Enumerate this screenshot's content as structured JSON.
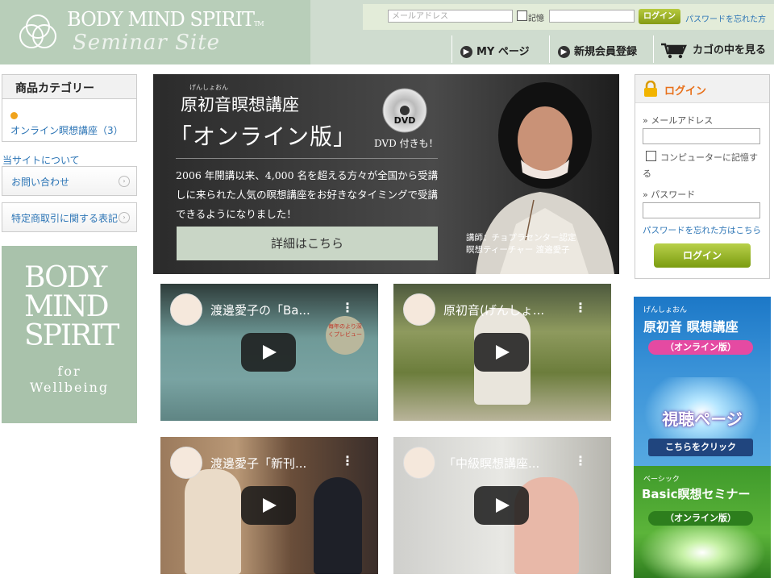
{
  "header": {
    "logo_main": "BODY MIND SPIRIT",
    "logo_tm": "TM",
    "logo_sub": "Seminar Site",
    "email_placeholder": "メールアドレス",
    "remember_label": "記憶",
    "login_button": "ログイン",
    "forgot_password": "パスワードを忘れた方",
    "nav": [
      {
        "label": "MY ページ",
        "icon": "arrow-right-icon"
      },
      {
        "label": "新規会員登録",
        "icon": "arrow-right-icon"
      },
      {
        "label": "カゴの中を見る",
        "icon": "cart-icon"
      }
    ]
  },
  "sidebar": {
    "category_title": "商品カテゴリー",
    "category_item": "オンライン瞑想講座（3）",
    "about_label": "当サイトについて",
    "links": [
      {
        "label": "お問い合わせ"
      },
      {
        "label": "特定商取引に関する表記"
      }
    ],
    "bms_logo": {
      "line1": "BODY",
      "line2": "MIND",
      "line3": "SPIRIT",
      "line4": "for",
      "line5": "Wellbeing"
    }
  },
  "hero": {
    "ruby": "げんしょおん",
    "title1": "原初音瞑想講座",
    "title2": "「オンライン版」",
    "dvd_label": "DVD",
    "dvd_note": "DVD 付きも！",
    "description": "2006 年開講以来、4,000 名を超える方々が全国から受講しに来られた人気の瞑想講座をお好きなタイミングで受講できるようになりました！",
    "detail_button": "詳細はこちら",
    "caption1": "講師：チョプラセンター認定",
    "caption2": "瞑想ティーチャー 渡邉愛子"
  },
  "videos": [
    {
      "title": "渡邊愛子の「Ba...",
      "overlay": "毎年のより深くプレビュー"
    },
    {
      "title": "原初音(げんしょ..."
    },
    {
      "title": "渡邊愛子「新刊..."
    },
    {
      "title": "「中級瞑想講座..."
    }
  ],
  "login": {
    "title": "ログイン",
    "email_label": "メールアドレス",
    "remember_label": "コンピューターに記憶する",
    "password_label": "パスワード",
    "forgot": "パスワードを忘れた方はこちら",
    "button": "ログイン"
  },
  "banners": [
    {
      "ruby": "げんしょおん",
      "title": "原初音 瞑想講座",
      "pill": "（オンライン版）",
      "main": "視聴ページ",
      "cta": "こちらをクリック"
    },
    {
      "ruby": "ベーシック",
      "title": "Basic瞑想セミナー",
      "pill": "（オンライン版）"
    }
  ],
  "colors": {
    "header_green": "#b8ceb9",
    "link_blue": "#2b74b5",
    "button_green": "#849b14",
    "accent_orange": "#e8701a"
  }
}
